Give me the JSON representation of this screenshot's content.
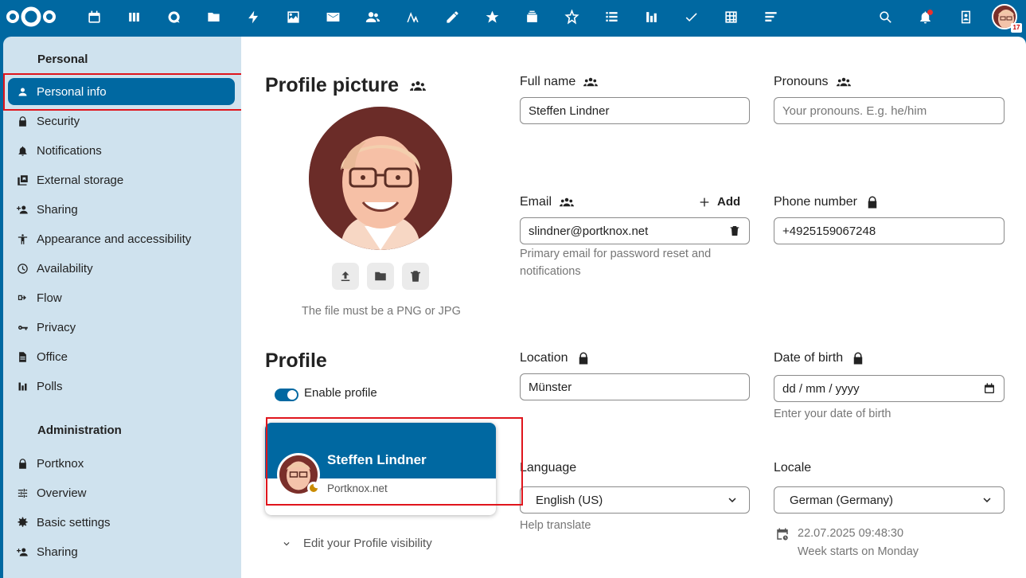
{
  "topbar": {
    "apps": [
      "dashboard-icon",
      "calendar-icon",
      "deck-icon",
      "talk-icon",
      "files-icon",
      "activity-icon",
      "photos-icon",
      "mail-icon",
      "contacts-icon",
      "analytics-icon",
      "notes-icon",
      "starred-icon",
      "stack-icon",
      "spreed-icon",
      "tasks-icon",
      "polls-icon",
      "checkmark-icon",
      "tables-icon",
      "forms-icon"
    ],
    "calendar_badge": "17"
  },
  "sidebar": {
    "personal_heading": "Personal",
    "personal_items": [
      {
        "label": "Personal info",
        "icon": "user-icon"
      },
      {
        "label": "Security",
        "icon": "lock-icon"
      },
      {
        "label": "Notifications",
        "icon": "bell-icon"
      },
      {
        "label": "External storage",
        "icon": "storage-icon"
      },
      {
        "label": "Sharing",
        "icon": "share-icon"
      },
      {
        "label": "Appearance and accessibility",
        "icon": "accessibility-icon"
      },
      {
        "label": "Availability",
        "icon": "clock-icon"
      },
      {
        "label": "Flow",
        "icon": "flow-icon"
      },
      {
        "label": "Privacy",
        "icon": "key-icon"
      },
      {
        "label": "Office",
        "icon": "document-icon"
      },
      {
        "label": "Polls",
        "icon": "poll-icon"
      }
    ],
    "admin_heading": "Administration",
    "admin_items": [
      {
        "label": "Portknox",
        "icon": "lock-icon"
      },
      {
        "label": "Overview",
        "icon": "tune-icon"
      },
      {
        "label": "Basic settings",
        "icon": "gear-icon"
      },
      {
        "label": "Sharing",
        "icon": "share-icon"
      }
    ]
  },
  "profile_picture": {
    "title": "Profile picture",
    "hint": "The file must be a PNG or JPG"
  },
  "fields": {
    "full_name": {
      "label": "Full name",
      "value": "Steffen Lindner"
    },
    "pronouns": {
      "label": "Pronouns",
      "placeholder": "Your pronouns. E.g. he/him"
    },
    "email": {
      "label": "Email",
      "add_label": "Add",
      "value": "slindner@portknox.net",
      "hint": "Primary email for password reset and notifications"
    },
    "phone": {
      "label": "Phone number",
      "value": "+4925159067248"
    },
    "location": {
      "label": "Location",
      "value": "Münster"
    },
    "birth": {
      "label": "Date of birth",
      "placeholder": "dd / mm / yyyy",
      "hint": "Enter your date of birth"
    },
    "language": {
      "label": "Language",
      "value": "English (US)",
      "hint": "Help translate"
    },
    "locale": {
      "label": "Locale",
      "value": "German (Germany)",
      "datetime": "22.07.2025 09:48:30",
      "week": "Week starts on Monday"
    }
  },
  "profile": {
    "title": "Profile",
    "enable_label": "Enable profile",
    "enabled": true,
    "card_name": "Steffen Lindner",
    "card_org": "Portknox.net",
    "visibility_label": "Edit your Profile visibility"
  },
  "colors": {
    "primary": "#0068a1",
    "highlight": "#e0151c"
  }
}
